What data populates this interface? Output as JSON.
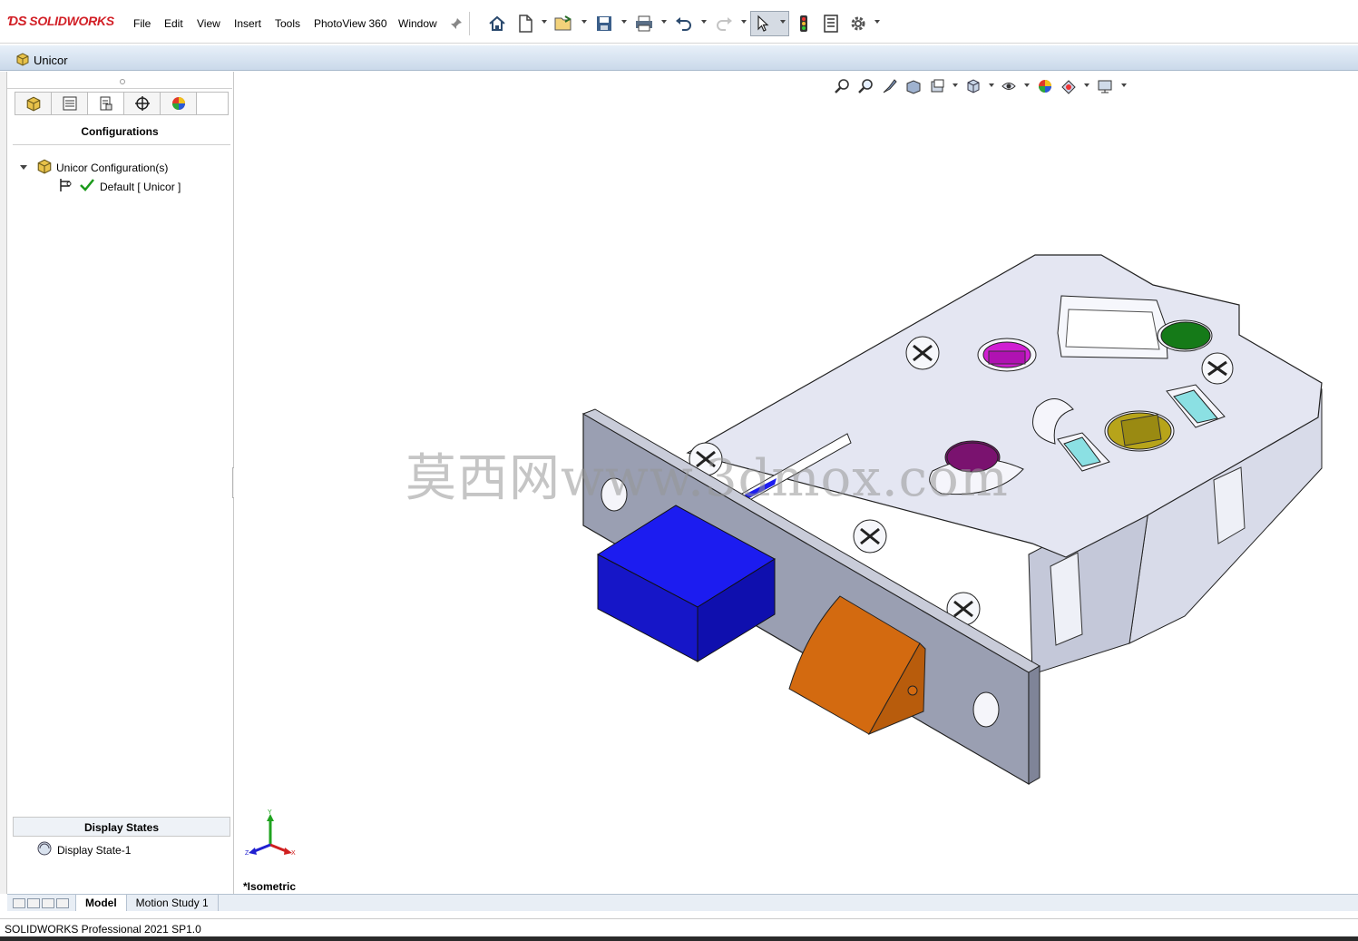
{
  "app": {
    "logo": "SOLIDWORKS",
    "menu": [
      "File",
      "Edit",
      "View",
      "Insert",
      "Tools",
      "PhotoView 360",
      "Window"
    ]
  },
  "document": {
    "title": "Unicor"
  },
  "panel": {
    "title": "Configurations",
    "tree_root": "Unicor Configuration(s)",
    "tree_child": "Default [ Unicor ]",
    "display_states_title": "Display States",
    "display_state": "Display State-1"
  },
  "viewport": {
    "view_label": "*Isometric",
    "watermark": "莫西网www.3dmox.com",
    "triad": {
      "x": "X",
      "y": "Y",
      "z": "Z"
    }
  },
  "tabs": {
    "model": "Model",
    "motion": "Motion Study 1"
  },
  "status": {
    "text": "SOLIDWORKS Professional 2021 SP1.0"
  },
  "colors": {
    "bolt": "#1c1cf0",
    "latch": "#d36a10",
    "plate": "#9a9fb2",
    "body": "#e4e6f2",
    "magenta": "#d01fd2",
    "green": "#157a18",
    "olive": "#b7a41a",
    "purple": "#7a126f",
    "cyan": "#8be0e3"
  },
  "icons": [
    "home-icon",
    "new-icon",
    "open-icon",
    "save-icon",
    "print-icon",
    "undo-icon",
    "redo-icon",
    "select-icon",
    "traffic-light-icon",
    "file-properties-icon",
    "options-icon"
  ]
}
